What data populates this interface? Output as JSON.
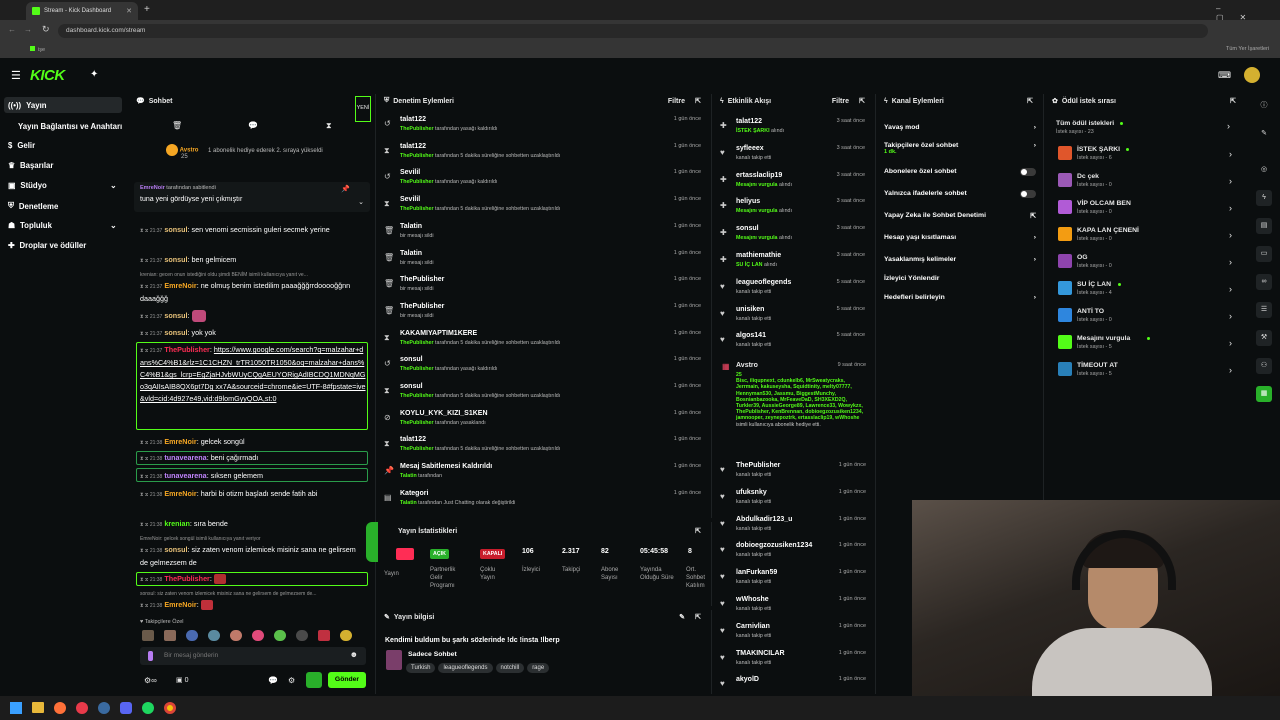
{
  "browser": {
    "tab_title": "Stream - Kick Dashboard",
    "url": "dashboard.kick.com/stream",
    "bookmarks_label": "Tüm Yer İşaretleri",
    "bookmark_item": "işe"
  },
  "brand": {
    "logo": "KICK",
    "accent": "#53fc18"
  },
  "sidebar": {
    "items": [
      {
        "label": "Yayın"
      },
      {
        "label": "Yayın Bağlantısı ve Anahtarı"
      },
      {
        "label": "Gelir"
      },
      {
        "label": "Başarılar"
      },
      {
        "label": "Stüdyo"
      },
      {
        "label": "Denetleme"
      },
      {
        "label": "Topluluk"
      },
      {
        "label": "Droplar ve ödüller"
      }
    ]
  },
  "chat": {
    "title": "Sohbet",
    "new_label": "YENİ",
    "gift_user": "Avstro",
    "gift_count": "25",
    "gift_text": "1 abonelik hediye ederek 2. sıraya yükseldi",
    "pinned_user": "EmreNoir",
    "pinned_suffix": "tarafından sabitlendi",
    "pinned_text": "tuna yeni gördüyse yeni çıkmıştır",
    "messages": [
      {
        "time": "21:37",
        "user": "sonsul",
        "color": "#e8c27a",
        "text": "sen venomi secmissin guleri secmek yerine"
      },
      {
        "time": "21:37",
        "user": "sonsul",
        "color": "#e8c27a",
        "text": "ben gelmicem"
      },
      {
        "reply": "krenian: gecen onun istediğini oldu şimdi BENİM isimli kullanıcıya yanıt ve..."
      },
      {
        "time": "21:37",
        "user": "EmreNoir",
        "color": "#f5a623",
        "text": "ne olmuş benim istedilim paaağğğrrdooooğğnn daaağğğ"
      },
      {
        "time": "21:37",
        "user": "sonsul",
        "color": "#e8c27a",
        "text": ""
      },
      {
        "time": "21:37",
        "user": "sonsul",
        "color": "#e8c27a",
        "text": "yok yok"
      },
      {
        "time": "21:37",
        "user": "ThePublisher",
        "color": "#ff2d55",
        "text": "https://www.google.com/search?q=malzahar+dans%C4%B1&rlz=1C1CHZN_trTR1050TR1050&oq=malzahar+dans%C4%B1&gs_lcrp=EgZjaHJvbWUyCQgAEUYORigAdIBCDQ1MDNqMGo3qAIIsAIB8QX6pt7Dg xx7A&sourceid=chrome&ie=UTF-8#fpstate=ive&vld=cid:4d927e49,vid:d9lomGyyQOA,st:0"
      },
      {
        "time": "21:38",
        "user": "EmreNoir",
        "color": "#f5a623",
        "text": "gelcek songül"
      },
      {
        "time": "21:38",
        "user": "tunavearena",
        "color": "#c084fc",
        "text": "beni çağırmadı"
      },
      {
        "time": "21:38",
        "user": "tunavearena",
        "color": "#c084fc",
        "text": "sıksen gelemem"
      },
      {
        "time": "21:38",
        "user": "EmreNoir",
        "color": "#f5a623",
        "text": "harbi bi otizm başladı sende fatih abi"
      },
      {
        "time": "21:38",
        "user": "krenian",
        "color": "#53fc18",
        "text": "sıra bende"
      },
      {
        "reply": "EmreNoir: gelcek songül isimli kullanıcıya yanıt veriyor"
      },
      {
        "time": "21:38",
        "user": "sonsul",
        "color": "#e8c27a",
        "text": "siz zaten venom izlemicek misiniz sana ne gelirsem de gelmezsem de"
      },
      {
        "time": "21:38",
        "user": "ThePublisher",
        "color": "#ff2d55",
        "text": ""
      },
      {
        "reply": "sonsul: siz zaten venom izlemicek misiniz sana ne gelirsem de gelmezsem de..."
      },
      {
        "time": "21:38",
        "user": "EmreNoir",
        "color": "#f5a623",
        "text": ""
      }
    ],
    "followers_only_label": "Takipçilere Özel",
    "input_placeholder": "Bir mesaj gönderin",
    "send_label": "Gönder",
    "footer_count": "0"
  },
  "moderation": {
    "title": "Denetim Eylemleri",
    "filter": "Filtre",
    "items": [
      {
        "icon": "↺",
        "name": "talat122",
        "by": "ThePublisher",
        "rest": " tarafından yasağı kaldırıldı",
        "time": "1 gün önce"
      },
      {
        "icon": "⧗",
        "name": "talat122",
        "by": "ThePublisher",
        "rest": " tarafından 5 dakika süreliğine sohbetten uzaklaştırıldı",
        "time": "1 gün önce"
      },
      {
        "icon": "↺",
        "name": "Sevilil",
        "by": "ThePublisher",
        "rest": " tarafından yasağı kaldırıldı",
        "time": "1 gün önce"
      },
      {
        "icon": "⧗",
        "name": "Sevilil",
        "by": "ThePublisher",
        "rest": " tarafından 5 dakika süreliğine sohbetten uzaklaştırıldı",
        "time": "1 gün önce"
      },
      {
        "icon": "🗑",
        "name": "Talatin",
        "by": "",
        "rest": "bir mesajı sildi",
        "time": "1 gün önce"
      },
      {
        "icon": "🗑",
        "name": "Talatin",
        "by": "",
        "rest": "bir mesajı sildi",
        "time": "1 gün önce"
      },
      {
        "icon": "🗑",
        "name": "ThePublisher",
        "by": "",
        "rest": "bir mesajı sildi",
        "time": "1 gün önce"
      },
      {
        "icon": "🗑",
        "name": "ThePublisher",
        "by": "",
        "rest": "bir mesajı sildi",
        "time": "1 gün önce"
      },
      {
        "icon": "⧗",
        "name": "KAKAMIYAPTIM1KERE",
        "by": "ThePublisher",
        "rest": " tarafından 5 dakika süreliğine sohbetten uzaklaştırıldı",
        "time": "1 gün önce"
      },
      {
        "icon": "↺",
        "name": "sonsul",
        "by": "ThePublisher",
        "rest": " tarafından yasağı kaldırıldı",
        "time": "1 gün önce"
      },
      {
        "icon": "⧗",
        "name": "sonsul",
        "by": "ThePublisher",
        "rest": " tarafından 5 dakika süreliğine sohbetten uzaklaştırıldı",
        "time": "1 gün önce"
      },
      {
        "icon": "⊘",
        "name": "KOYLU_KYK_KIZI_S1KEN",
        "by": "ThePublisher",
        "rest": " tarafından yasaklandı",
        "time": "1 gün önce"
      },
      {
        "icon": "⧗",
        "name": "talat122",
        "by": "ThePublisher",
        "rest": " tarafından 5 dakika süreliğine sohbetten uzaklaştırıldı",
        "time": "1 gün önce"
      },
      {
        "icon": "📌",
        "name": "Mesaj Sabitlemesi Kaldırıldı",
        "by": "Talatin",
        "rest": " tarafından",
        "time": "1 gün önce"
      },
      {
        "icon": "▤",
        "name": "Kategori",
        "by": "Talatin",
        "rest": " tarafından Just Chatting olarak değiştirildi",
        "time": "1 gün önce"
      }
    ]
  },
  "stats": {
    "title": "Yayın İstatistikleri",
    "badges": [
      "AÇIK",
      "KAPALI"
    ],
    "values": [
      "106",
      "2.317",
      "82",
      "05:45:58",
      "8"
    ],
    "labels": [
      "Yayın",
      "Partnerlik Gelir Programı",
      "Çoklu Yayın",
      "İzleyici",
      "Takipçi",
      "Abone Sayısı",
      "Yayında Olduğu Süre",
      "Ort. Sohbet Katılım"
    ]
  },
  "stream_info": {
    "title": "Yayın bilgisi",
    "stream_title": "Kendimi buldum bu şarkı sözlerinde !dc !insta !lberp",
    "category": "Sadece Sohbet",
    "tags": [
      "Turkish",
      "leagueoflegends",
      "notchill",
      "rage"
    ]
  },
  "activity": {
    "title": "Etkinlik Akışı",
    "filter": "Filtre",
    "items": [
      {
        "icon": "✚",
        "name": "talat122",
        "sub": "İSTEK ŞARKI",
        "rest": " alındı",
        "time": "3 saat önce",
        "green": true
      },
      {
        "icon": "♥",
        "name": "syfleeex",
        "sub": "",
        "rest": "kanalı takip etti",
        "time": "3 saat önce",
        "green": false
      },
      {
        "icon": "✚",
        "name": "ertasslaclip19",
        "sub": "Mesajını vurgula",
        "rest": " alındı",
        "time": "3 saat önce",
        "green": true
      },
      {
        "icon": "✚",
        "name": "heliyus",
        "sub": "Mesajını vurgula",
        "rest": " alındı",
        "time": "3 saat önce",
        "green": true
      },
      {
        "icon": "✚",
        "name": "sonsul",
        "sub": "Mesajını vurgula",
        "rest": " alındı",
        "time": "3 saat önce",
        "green": true
      },
      {
        "icon": "✚",
        "name": "mathiemathie",
        "sub": "SU İÇ LAN",
        "rest": " alındı",
        "time": "3 saat önce",
        "green": true
      },
      {
        "icon": "♥",
        "name": "leagueoflegends",
        "sub": "",
        "rest": "kanalı takip etti",
        "time": "5 saat önce",
        "green": false
      },
      {
        "icon": "♥",
        "name": "unisiken",
        "sub": "",
        "rest": "kanalı takip etti",
        "time": "5 saat önce",
        "green": false
      },
      {
        "icon": "♥",
        "name": "algos141",
        "sub": "",
        "rest": "kanalı takip etti",
        "time": "5 saat önce",
        "green": false
      }
    ],
    "gift": {
      "name": "Avstro",
      "time": "9 saat önce",
      "count": "25",
      "text": "Bisc, iliqupnext, cdunkelb6, MrSweatycraks, Jerrmain, kakuseysha, Squidtinity, melty07777, Hennyman530, Jassmu, BiggestMunchy, Bosnianbazooka, MrFeaveDaD, SH3XEXD2Q, Turkler39, AussieGeorge89, Lawrence33, Wowykzx, ThePublisher, KenBrennan, dobioegzozusiken1234, jamnooper, zeynepoztrk, ertasslaclip19, wWhoshe",
      "suffix": "isimli kullanıcıya abonelik hediye etti."
    },
    "items2": [
      {
        "icon": "♥",
        "name": "ThePublisher",
        "rest": "kanalı takip etti",
        "time": "1 gün önce"
      },
      {
        "icon": "♥",
        "name": "ufuksnky",
        "rest": "kanalı takip etti",
        "time": "1 gün önce"
      },
      {
        "icon": "♥",
        "name": "Abdulkadir123_u",
        "rest": "kanalı takip etti",
        "time": "1 gün önce"
      },
      {
        "icon": "♥",
        "name": "dobioegzozusiken1234",
        "rest": "kanalı takip etti",
        "time": "1 gün önce"
      },
      {
        "icon": "♥",
        "name": "lanFurkan59",
        "rest": "kanalı takip etti",
        "time": "1 gün önce"
      },
      {
        "icon": "♥",
        "name": "wWhoshe",
        "rest": "kanalı takip etti",
        "time": "1 gün önce"
      },
      {
        "icon": "♥",
        "name": "Carnivlian",
        "rest": "kanalı takip etti",
        "time": "1 gün önce"
      },
      {
        "icon": "♥",
        "name": "TMAKINCILAR",
        "rest": "kanalı takip etti",
        "time": "1 gün önce"
      },
      {
        "icon": "♥",
        "name": "akyolD",
        "rest": "",
        "time": "1 gün önce"
      }
    ]
  },
  "channel": {
    "title": "Kanal Eylemleri",
    "settings": [
      {
        "label": "Yavaş mod",
        "sub": "",
        "control": "arrow"
      },
      {
        "label": "Takipçilere özel sohbet",
        "sub": "1 dk.",
        "control": "arrow"
      },
      {
        "label": "Abonelere özel sohbet",
        "sub": "",
        "control": "toggle"
      },
      {
        "label": "Yalnızca ifadelerle sohbet",
        "sub": "",
        "control": "toggle"
      },
      {
        "label": "Yapay Zeka ile Sohbet Denetimi",
        "sub": "",
        "control": "ext"
      },
      {
        "label": "Hesap yaşı kısıtlaması",
        "sub": "",
        "control": "arrow"
      },
      {
        "label": "Yasaklanmış kelimeler",
        "sub": "",
        "control": "arrow"
      },
      {
        "label": "İzleyici Yönlendir",
        "sub": "",
        "control": "none"
      },
      {
        "label": "Hedefleri belirleyin",
        "sub": "",
        "control": "arrow"
      }
    ]
  },
  "rewards": {
    "title": "Ödül istek sırası",
    "all_label": "Tüm ödül istekleri",
    "all_count": "İstek sayısı - 23",
    "items": [
      {
        "name": "İSTEK ŞARKI",
        "count": "İstek sayısı - 6",
        "color": "#e0562b",
        "dot": true
      },
      {
        "name": "Dc çek",
        "count": "İstek sayısı - 0",
        "color": "#9b59b6",
        "dot": false
      },
      {
        "name": "VİP OLCAM BEN",
        "count": "İstek sayısı - 0",
        "color": "#b15bd6",
        "dot": false
      },
      {
        "name": "KAPA LAN ÇENENİ",
        "count": "İstek sayısı - 0",
        "color": "#f39c12",
        "dot": false
      },
      {
        "name": "OG",
        "count": "İstek sayısı - 0",
        "color": "#8e44ad",
        "dot": false
      },
      {
        "name": "SU İÇ LAN",
        "count": "İstek sayısı - 4",
        "color": "#3498db",
        "dot": true
      },
      {
        "name": "ANTİ TO",
        "count": "İstek sayısı - 0",
        "color": "#2e86de",
        "dot": false
      },
      {
        "name": "Mesajını vurgula",
        "count": "İstek sayısı - 5",
        "color": "#53fc18",
        "dot": true
      },
      {
        "name": "TİMEOUT AT",
        "count": "İstek sayısı - 5",
        "color": "#2980b9",
        "dot": false
      }
    ]
  }
}
